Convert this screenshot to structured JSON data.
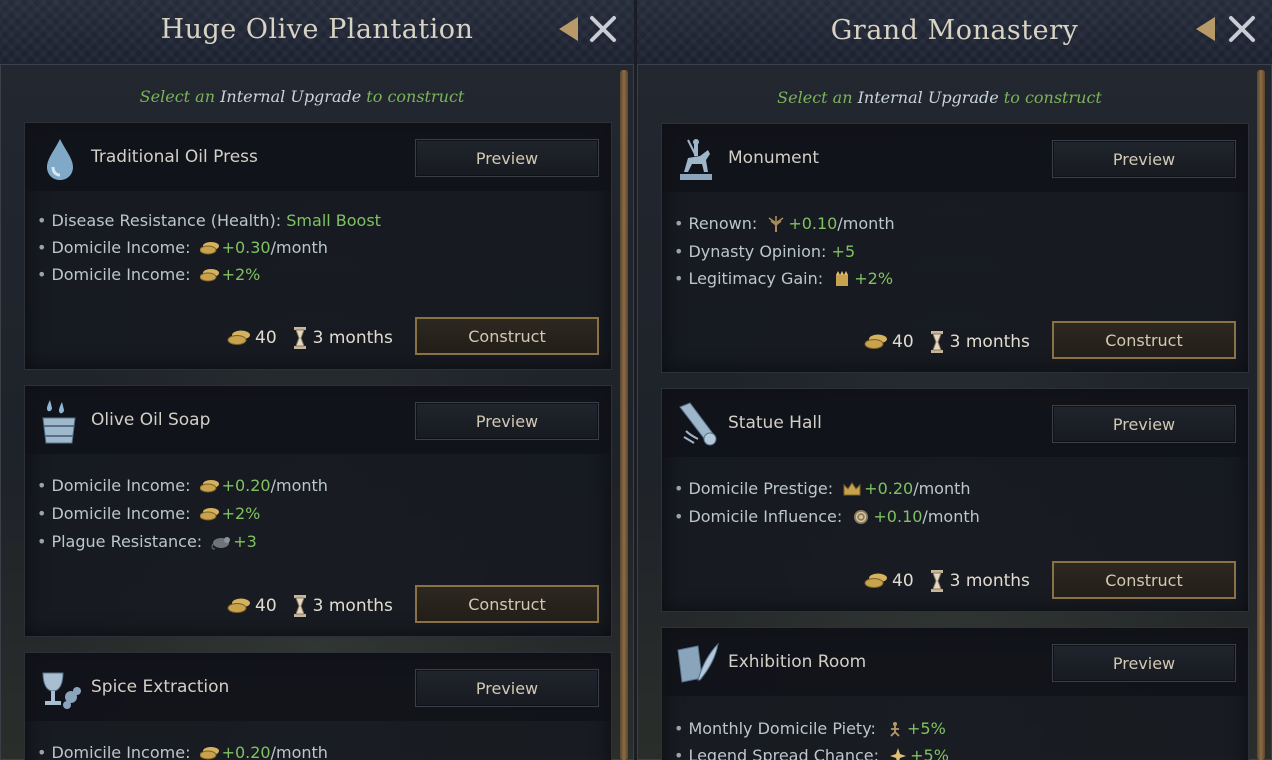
{
  "subtitle": {
    "pre": "Select an",
    "highlight": "Internal Upgrade",
    "post": "to construct"
  },
  "left": {
    "title": "Huge Olive Plantation",
    "cards": [
      {
        "name": "Traditional Oil Press",
        "icon": "water-drop-icon",
        "preview_label": "Preview",
        "construct_label": "Construct",
        "cost": "40",
        "time": "3 months",
        "effects": [
          {
            "label": "Disease Resistance (Health):",
            "icon": "",
            "value": "Small Boost",
            "suffix": ""
          },
          {
            "label": "Domicile Income:",
            "icon": "gold-coins-icon",
            "value": "+0.30",
            "suffix": "/month"
          },
          {
            "label": "Domicile Income:",
            "icon": "gold-coins-icon",
            "value": "+2%",
            "suffix": ""
          }
        ]
      },
      {
        "name": "Olive Oil Soap",
        "icon": "bucket-icon",
        "preview_label": "Preview",
        "construct_label": "Construct",
        "cost": "40",
        "time": "3 months",
        "effects": [
          {
            "label": "Domicile Income:",
            "icon": "gold-coins-icon",
            "value": "+0.20",
            "suffix": "/month"
          },
          {
            "label": "Domicile Income:",
            "icon": "gold-coins-icon",
            "value": "+2%",
            "suffix": ""
          },
          {
            "label": "Plague Resistance:",
            "icon": "plague-rat-icon",
            "value": "+3",
            "suffix": ""
          }
        ]
      },
      {
        "name": "Spice Extraction",
        "icon": "chalice-icon",
        "preview_label": "Preview",
        "effects": [
          {
            "label": "Domicile Income:",
            "icon": "gold-coins-icon",
            "value": "+0.20",
            "suffix": "/month"
          }
        ]
      }
    ]
  },
  "right": {
    "title": "Grand Monastery",
    "cards": [
      {
        "name": "Monument",
        "icon": "equestrian-statue-icon",
        "preview_label": "Preview",
        "construct_label": "Construct",
        "cost": "40",
        "time": "3 months",
        "effects": [
          {
            "label": "Renown:",
            "icon": "renown-tree-icon",
            "value": "+0.10",
            "suffix": "/month"
          },
          {
            "label": "Dynasty Opinion:",
            "icon": "",
            "value": "+5",
            "suffix": ""
          },
          {
            "label": "Legitimacy Gain:",
            "icon": "legitimacy-icon",
            "value": "+2%",
            "suffix": ""
          }
        ]
      },
      {
        "name": "Statue Hall",
        "icon": "scroll-icon",
        "preview_label": "Preview",
        "construct_label": "Construct",
        "cost": "40",
        "time": "3 months",
        "effects": [
          {
            "label": "Domicile Prestige:",
            "icon": "crown-icon",
            "value": "+0.20",
            "suffix": "/month"
          },
          {
            "label": "Domicile Influence:",
            "icon": "influence-icon",
            "value": "+0.10",
            "suffix": "/month"
          }
        ]
      },
      {
        "name": "Exhibition Room",
        "icon": "book-quill-icon",
        "preview_label": "Preview",
        "effects": [
          {
            "label": "Monthly Domicile Piety:",
            "icon": "piety-icon",
            "value": "+5%",
            "suffix": ""
          },
          {
            "label": "Legend Spread Chance:",
            "icon": "star-icon",
            "value": "+5%",
            "suffix": ""
          }
        ]
      }
    ]
  }
}
